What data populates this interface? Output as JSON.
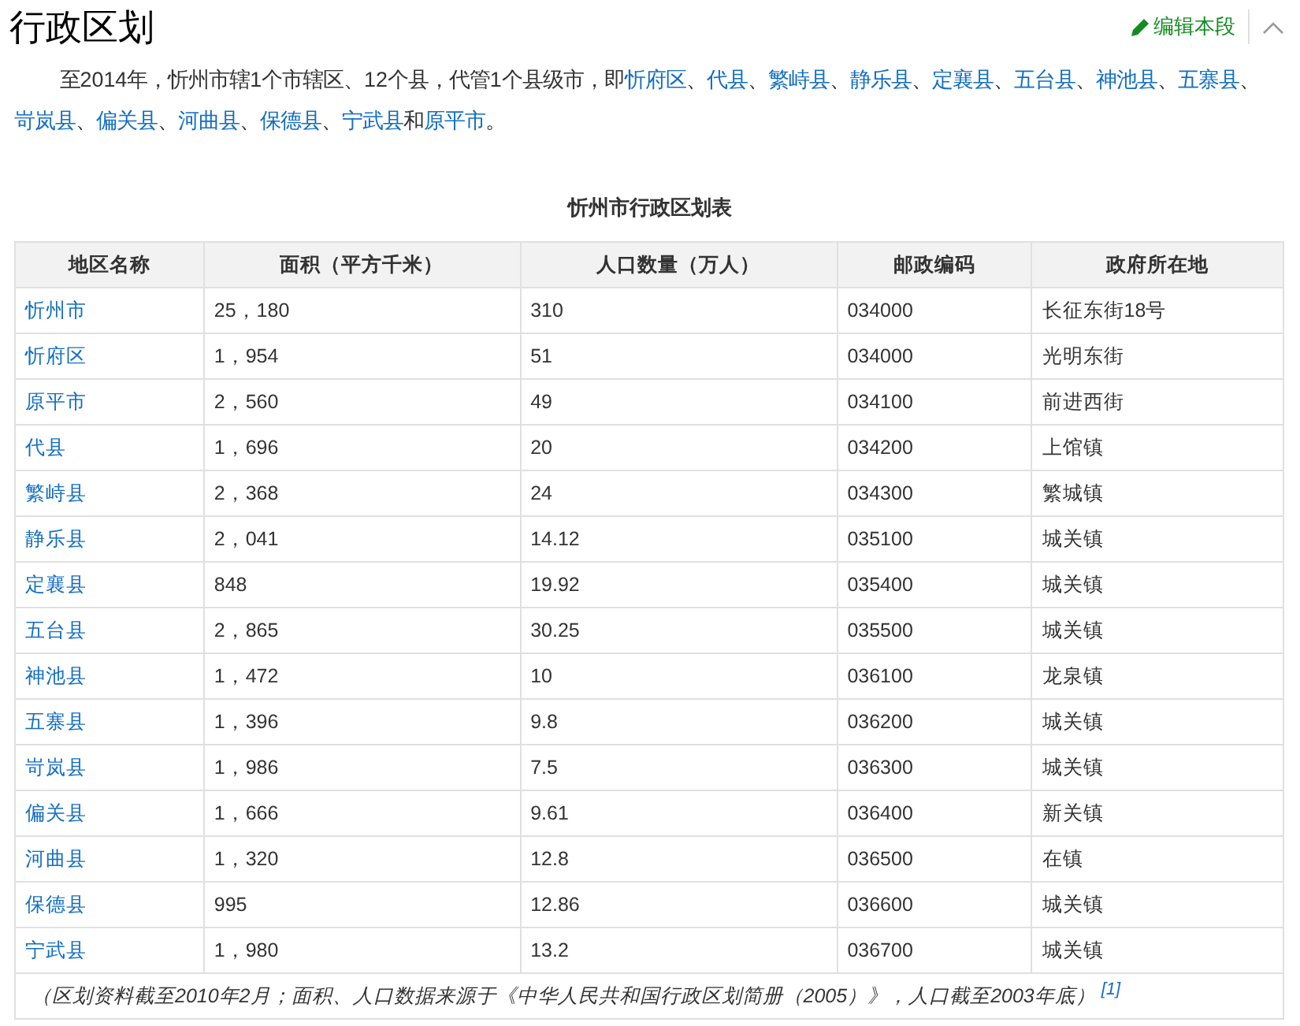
{
  "section": {
    "title": "行政区划",
    "edit_label": "编辑本段"
  },
  "paragraph": [
    {
      "text": "至2014年，忻州市辖1个市辖区、12个县，代管1个县级市，即",
      "link": false
    },
    {
      "text": "忻府区",
      "link": true
    },
    {
      "text": "、",
      "link": false
    },
    {
      "text": "代县",
      "link": true
    },
    {
      "text": "、",
      "link": false
    },
    {
      "text": "繁峙县",
      "link": true
    },
    {
      "text": "、",
      "link": false
    },
    {
      "text": "静乐县",
      "link": true
    },
    {
      "text": "、",
      "link": false
    },
    {
      "text": "定襄县",
      "link": true
    },
    {
      "text": "、",
      "link": false
    },
    {
      "text": "五台县",
      "link": true
    },
    {
      "text": "、",
      "link": false
    },
    {
      "text": "神池县",
      "link": true
    },
    {
      "text": "、",
      "link": false
    },
    {
      "text": "五寨县",
      "link": true
    },
    {
      "text": "、",
      "link": false
    },
    {
      "text": "岢岚县",
      "link": true
    },
    {
      "text": "、",
      "link": false
    },
    {
      "text": "偏关县",
      "link": true
    },
    {
      "text": "、",
      "link": false
    },
    {
      "text": "河曲县",
      "link": true
    },
    {
      "text": "、",
      "link": false
    },
    {
      "text": "保德县",
      "link": true
    },
    {
      "text": "、",
      "link": false
    },
    {
      "text": "宁武县",
      "link": true
    },
    {
      "text": "和",
      "link": false
    },
    {
      "text": "原平市",
      "link": true
    },
    {
      "text": "。",
      "link": false
    }
  ],
  "table": {
    "caption": "忻州市行政区划表",
    "columns": [
      "地区名称",
      "面积（平方千米）",
      "人口数量（万人）",
      "邮政编码",
      "政府所在地"
    ],
    "rows": [
      [
        "忻州市",
        "25，180",
        "310",
        "034000",
        "长征东街18号"
      ],
      [
        "忻府区",
        "1，954",
        "51",
        "034000",
        "光明东街"
      ],
      [
        "原平市",
        "2，560",
        "49",
        "034100",
        "前进西街"
      ],
      [
        "代县",
        "1，696",
        "20",
        "034200",
        "上馆镇"
      ],
      [
        "繁峙县",
        "2，368",
        "24",
        "034300",
        "繁城镇"
      ],
      [
        "静乐县",
        "2，041",
        "14.12",
        "035100",
        "城关镇"
      ],
      [
        "定襄县",
        "848",
        "19.92",
        "035400",
        "城关镇"
      ],
      [
        "五台县",
        "2，865",
        "30.25",
        "035500",
        "城关镇"
      ],
      [
        "神池县",
        "1，472",
        "10",
        "036100",
        "龙泉镇"
      ],
      [
        "五寨县",
        "1，396",
        "9.8",
        "036200",
        "城关镇"
      ],
      [
        "岢岚县",
        "1，986",
        "7.5",
        "036300",
        "城关镇"
      ],
      [
        "偏关县",
        "1，666",
        "9.61",
        "036400",
        "新关镇"
      ],
      [
        "河曲县",
        "1，320",
        "12.8",
        "036500",
        "在镇"
      ],
      [
        "保德县",
        "995",
        "12.86",
        "036600",
        "城关镇"
      ],
      [
        "宁武县",
        "1，980",
        "13.2",
        "036700",
        "城关镇"
      ]
    ],
    "footnote": "（区划资料截至2010年2月；面积、人口数据来源于《中华人民共和国行政区划简册（2005）》，人口截至2003年底）",
    "footnote_ref": "[1]"
  }
}
